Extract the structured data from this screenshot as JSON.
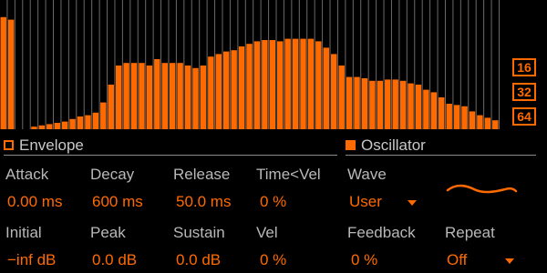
{
  "wave": {
    "bars": [
      0.88,
      0.86,
      0,
      0,
      0.02,
      0.03,
      0.04,
      0.05,
      0.06,
      0.08,
      0.1,
      0.11,
      0.13,
      0.21,
      0.35,
      0.5,
      0.52,
      0.52,
      0.52,
      0.5,
      0.55,
      0.52,
      0.52,
      0.52,
      0.5,
      0.48,
      0.5,
      0.57,
      0.59,
      0.61,
      0.62,
      0.65,
      0.67,
      0.69,
      0.7,
      0.7,
      0.69,
      0.71,
      0.71,
      0.71,
      0.71,
      0.69,
      0.64,
      0.59,
      0.5,
      0.41,
      0.41,
      0.4,
      0.38,
      0.38,
      0.39,
      0.39,
      0.38,
      0.36,
      0.35,
      0.31,
      0.29,
      0.25,
      0.2,
      0.19,
      0.18,
      0.14,
      0.11,
      0.09,
      0.07
    ],
    "color": "#ff6a00",
    "line_color": "#6a6a6a"
  },
  "length_buttons": [
    {
      "label": "16",
      "active": false
    },
    {
      "label": "32",
      "active": false
    },
    {
      "label": "64",
      "active": true
    }
  ],
  "envelope": {
    "title": "Envelope",
    "attack": {
      "label": "Attack",
      "value": "0.00 ms"
    },
    "decay": {
      "label": "Decay",
      "value": "600 ms"
    },
    "release": {
      "label": "Release",
      "value": "50.0 ms"
    },
    "time_vel": {
      "label": "Time<Vel",
      "value": "0 %"
    },
    "initial": {
      "label": "Initial",
      "value": "−inf dB"
    },
    "peak": {
      "label": "Peak",
      "value": "0.0 dB"
    },
    "sustain": {
      "label": "Sustain",
      "value": "0.0 dB"
    },
    "vel": {
      "label": "Vel",
      "value": "0 %"
    }
  },
  "oscillator": {
    "title": "Oscillator",
    "wave": {
      "label": "Wave",
      "value": "User"
    },
    "feedback": {
      "label": "Feedback",
      "value": "0 %"
    },
    "repeat": {
      "label": "Repeat",
      "value": "Off"
    }
  },
  "colors": {
    "accent": "#ff6a00",
    "label": "#b8b8b8",
    "background": "#000000"
  }
}
